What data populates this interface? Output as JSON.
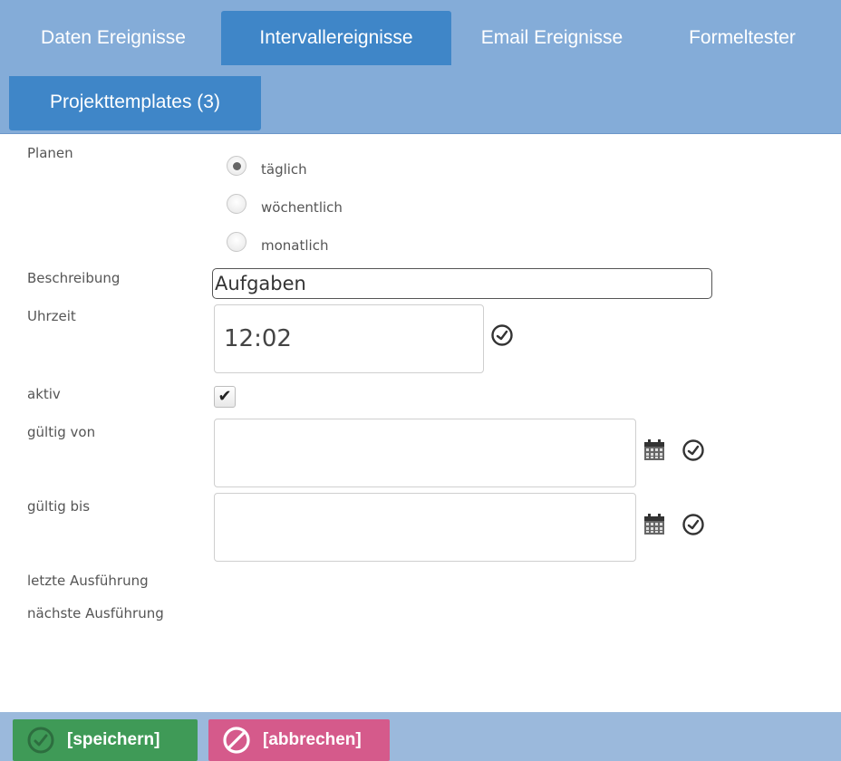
{
  "tabs": [
    {
      "label": "Daten Ereignisse",
      "active": false
    },
    {
      "label": "Intervallereignisse",
      "active": true
    },
    {
      "label": "Email Ereignisse",
      "active": false
    },
    {
      "label": "Formeltester",
      "active": false
    },
    {
      "label": "Projekttemplates (3)",
      "active": false
    }
  ],
  "form": {
    "planen_label": "Planen",
    "schedule_options": [
      {
        "label": "täglich",
        "checked": true
      },
      {
        "label": "wöchentlich",
        "checked": false
      },
      {
        "label": "monatlich",
        "checked": false
      }
    ],
    "beschreibung_label": "Beschreibung",
    "beschreibung_value": "Aufgaben",
    "uhrzeit_label": "Uhrzeit",
    "uhrzeit_value": "12:02",
    "aktiv_label": "aktiv",
    "aktiv_checked": true,
    "aktiv_mark": "✔",
    "gueltig_von_label": "gültig von",
    "gueltig_von_value": "",
    "gueltig_bis_label": "gültig bis",
    "gueltig_bis_value": "",
    "letzte_label": "letzte Ausführung",
    "naechste_label": "nächste Ausführung"
  },
  "footer": {
    "save_label": "[speichern]",
    "cancel_label": "[abbrechen]"
  },
  "icons": {
    "clock": "clock-icon",
    "calendar": "calendar-icon",
    "save": "check-circle-icon",
    "cancel": "ban-icon"
  },
  "colors": {
    "tab_bar": "#84acd8",
    "tab_active": "#3f86c8",
    "save": "#3f9a57",
    "cancel": "#d55a8b",
    "footer": "#9bb9dc"
  }
}
